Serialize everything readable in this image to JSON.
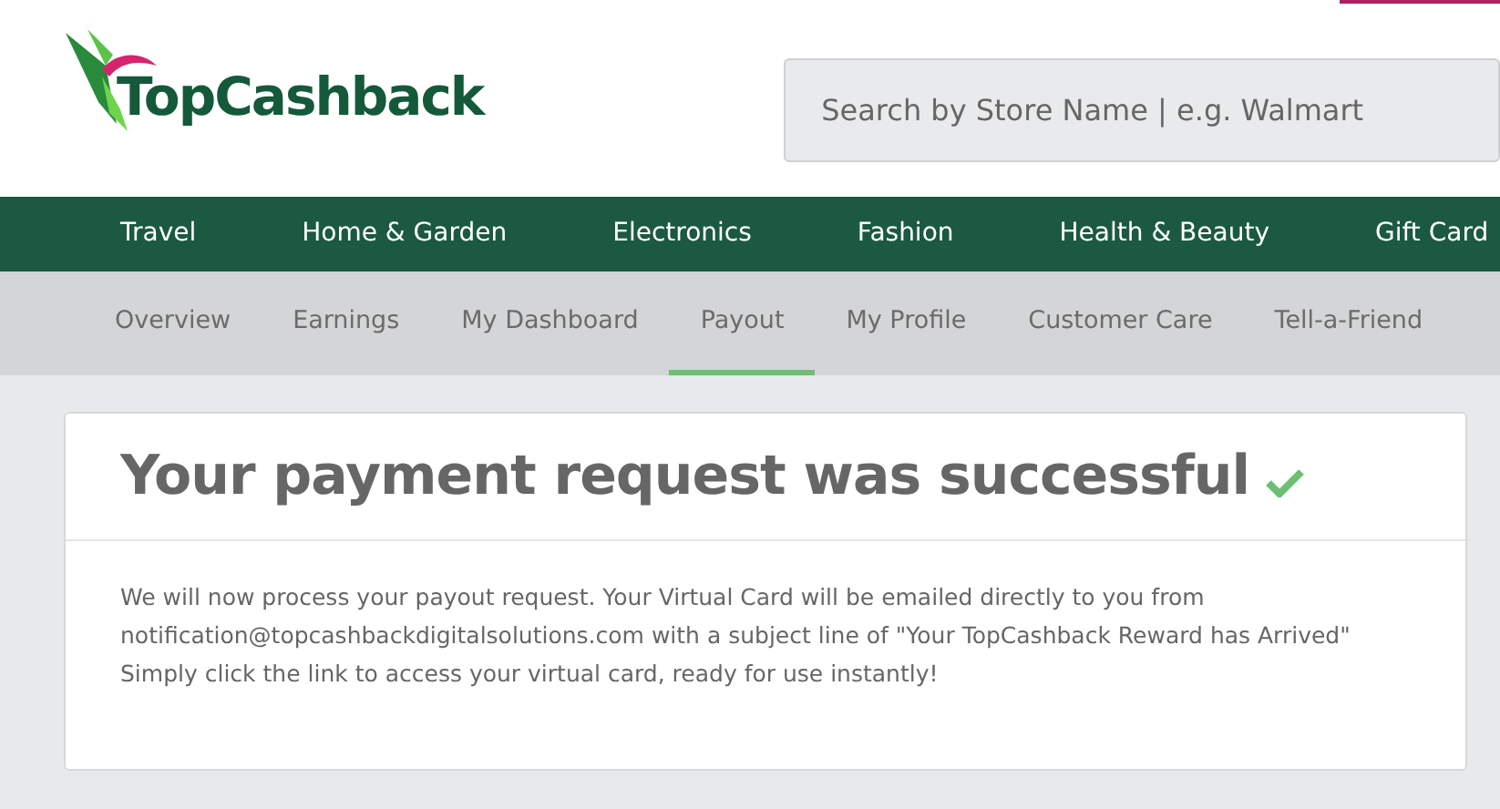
{
  "logo": {
    "text": "TopCashback"
  },
  "search": {
    "placeholder": "Search by Store Name | e.g. Walmart"
  },
  "categories": [
    "Travel",
    "Home & Garden",
    "Electronics",
    "Fashion",
    "Health & Beauty",
    "Gift Card"
  ],
  "account_tabs": [
    {
      "label": "Overview",
      "selected": false
    },
    {
      "label": "Earnings",
      "selected": false
    },
    {
      "label": "My Dashboard",
      "selected": false
    },
    {
      "label": "Payout",
      "selected": true
    },
    {
      "label": "My Profile",
      "selected": false
    },
    {
      "label": "Customer Care",
      "selected": false
    },
    {
      "label": "Tell-a-Friend",
      "selected": false
    }
  ],
  "card": {
    "title": "Your payment request was successful",
    "message": "We will now process your payout request. Your Virtual Card will be emailed directly to you from notification@topcashbackdigitalsolutions.com with a subject line of \"Your TopCashback Reward has Arrived\" Simply click the link to access your virtual card, ready for use instantly!"
  }
}
